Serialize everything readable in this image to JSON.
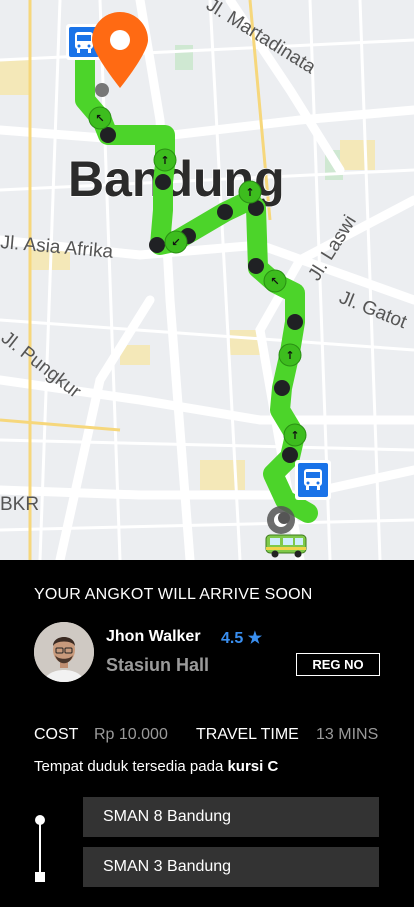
{
  "map": {
    "city_label": "Bandung",
    "street_labels": [
      "Jl. Martadinata",
      "Jl. Asia Afrika",
      "Jl. Laswi",
      "Jl. Gatot",
      "Jl. Pungkur",
      "BKR"
    ],
    "route_color": "#4cd42a",
    "pin_color": "#ff6a13",
    "bus_stop_color": "#1a73e8"
  },
  "trip": {
    "banner": "YOUR ANGKOT WILL ARRIVE SOON",
    "driver_name": "Jhon Walker",
    "rating": "4.5 ★",
    "station": "Stasiun Hall",
    "reg_button": "REG NO",
    "cost_label": "COST",
    "cost_value": "Rp 10.000",
    "time_label": "TRAVEL TIME",
    "time_value": "13 MINS",
    "seat_text": "Tempat duduk tersedia pada ",
    "seat_value": "kursi C",
    "stops": [
      "SMAN 8 Bandung",
      "SMAN 3 Bandung"
    ]
  }
}
